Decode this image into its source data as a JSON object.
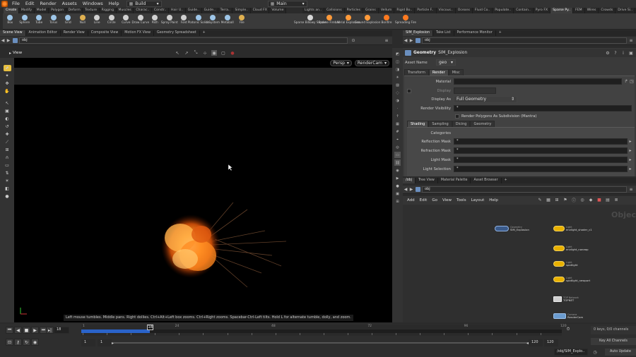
{
  "menu": {
    "items": [
      "File",
      "Edit",
      "Render",
      "Assets",
      "Windows",
      "Help"
    ],
    "desktop": "Build",
    "desktop_right": "Main"
  },
  "shelf_tabs_left": [
    "Create",
    "Modify",
    "Model",
    "Polygon",
    "Deform",
    "Texture",
    "Rigging",
    "Muscles",
    "Charac..",
    "Constr..",
    "Hair U..",
    "Guide..",
    "Guide..",
    "Terra..",
    "Simple..",
    "Cloud FX",
    "Volume"
  ],
  "shelf_tabs_right": [
    "Lights an..",
    "Collisions",
    "Particles",
    "Grains",
    "Vellum",
    "Rigid Bo..",
    "Particle F..",
    "Viscous..",
    "Oceans",
    "Fluid Co..",
    "Populate..",
    "Contain..",
    "Pyro FX",
    "Sparse Py..",
    "FEM",
    "Wires",
    "Crowds",
    "Drive Si.."
  ],
  "shelf_tools_left": [
    {
      "label": "Box",
      "color": "#9ec6e8"
    },
    {
      "label": "Sphere",
      "color": "#9ec6e8"
    },
    {
      "label": "Tube",
      "color": "#9ec6e8"
    },
    {
      "label": "Torus",
      "color": "#9ec6e8"
    },
    {
      "label": "Grid",
      "color": "#9ec6e8"
    },
    {
      "label": "Null",
      "color": "#e0b050"
    },
    {
      "label": "Line",
      "color": "#d0d0d0"
    },
    {
      "label": "Circle",
      "color": "#d0d0d0"
    },
    {
      "label": "Curve",
      "color": "#d0d0d0"
    },
    {
      "label": "Draw Curve",
      "color": "#d0d0d0"
    },
    {
      "label": "Path",
      "color": "#d0d0d0"
    },
    {
      "label": "Spray Paint",
      "color": "#d0d0d0"
    },
    {
      "label": "Font",
      "color": "#d0d0d0"
    },
    {
      "label": "Platonic Solids",
      "color": "#9ec6e8"
    },
    {
      "label": "L-System",
      "color": "#9ec6e8"
    },
    {
      "label": "Metaball",
      "color": "#9ec6e8"
    },
    {
      "label": "File",
      "color": "#e0b050"
    }
  ],
  "shelf_tools_right": [
    {
      "label": "Sparse Billowy Smoke",
      "color": "#d8d8d8"
    },
    {
      "label": "Sparse Fireball",
      "color": "#ff9a3a"
    },
    {
      "label": "Aerial Explosion",
      "color": "#ff9a3a"
    },
    {
      "label": "Ground Explosion",
      "color": "#ff9a3a"
    },
    {
      "label": "Bonfire",
      "color": "#ff7a20"
    },
    {
      "label": "Spreading Fire",
      "color": "#ff7a20"
    }
  ],
  "left_pane": {
    "tabs": [
      "Scene View",
      "Animation Editor",
      "Render View",
      "Composite View",
      "Motion FX View",
      "Geometry Spreadsheet"
    ],
    "path": "obj",
    "view_label": "View",
    "persp": "Persp",
    "camera": "RenderCam",
    "hint": "Left mouse tumbles. Middle pans. Right dollies. Ctrl+Alt+Left box zooms. Ctrl+Right zooms. Spacebar-Ctrl-Left tilts. Hold L for alternate tumble, dolly, and zoom."
  },
  "params": {
    "tabs": [
      "SIM_Explosion",
      "Take List",
      "Performance Monitor"
    ],
    "path": "obj",
    "node_type": "Geometry",
    "node_name": "SIM_Explosion",
    "asset_name_label": "Asset Name",
    "asset_name_value": "geo",
    "folder_tabs": [
      "Transform",
      "Render",
      "Misc"
    ],
    "active_folder": "Render",
    "material_label": "Material",
    "display_label": "Display",
    "display_as_label": "Display As",
    "display_as_value": "Full Geometry",
    "render_vis_label": "Render Visibility",
    "render_vis_value": "*",
    "render_poly_label": "Render Polygons As Subdivision (Mantra)",
    "sub_tabs": [
      "Shading",
      "Sampling",
      "Dicing",
      "Geometry"
    ],
    "categories_label": "Categories",
    "reflection_label": "Reflection Mask",
    "reflection_value": "*",
    "refraction_label": "Refraction Mask",
    "refraction_value": "*",
    "lightmask_label": "Light Mask",
    "lightmask_value": "*",
    "lightsel_label": "Light Selection",
    "lightsel_value": "*"
  },
  "network": {
    "tabs": [
      "/obj",
      "Tree View",
      "Material Palette",
      "Asset Browser"
    ],
    "path": "obj",
    "menu": [
      "Add",
      "Edit",
      "Go",
      "View",
      "Tools",
      "Layout",
      "Help"
    ],
    "watermark": "Objec",
    "nodes": [
      {
        "name": "SIM_Explosion",
        "sub": "Geometry"
      },
      {
        "name": "envlight_shader_c1",
        "sub": "Light"
      },
      {
        "name": "envlight_noneap",
        "sub": "Light"
      },
      {
        "name": "spotlight",
        "sub": "Light"
      },
      {
        "name": "spotlight_newport",
        "sub": "Light"
      },
      {
        "name": "TOPNET",
        "sub": "TOP Network"
      },
      {
        "name": "RenderCam",
        "sub": "Camera"
      }
    ]
  },
  "timeline": {
    "current_frame": "18",
    "ticks": [
      "1",
      "24",
      "48",
      "72",
      "96",
      "120"
    ],
    "marker_value": "18",
    "start": "1",
    "range_start": "1",
    "range_end": "120",
    "end": "120",
    "path_field": "/obj/SIM_Explo..",
    "keys_info": "0 keys, 0/0 channels",
    "all_channels": "Key All Channels",
    "auto_update": "Auto Update",
    "playhead_fraction": 0.143
  },
  "colors": {
    "node_yellow": "#e9b100",
    "playbar_blue": "#2a63c9",
    "accent_orange": "#ff8a2a"
  }
}
